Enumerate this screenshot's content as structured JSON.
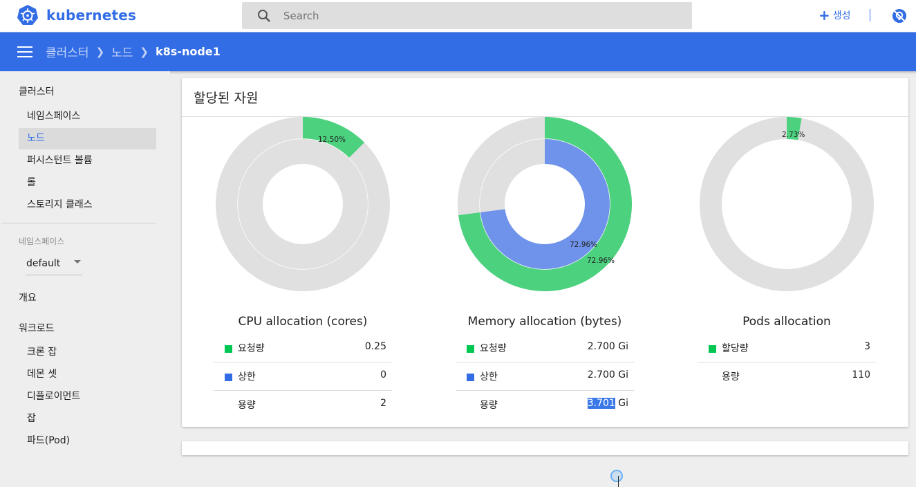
{
  "app": {
    "brand": "kubernetes"
  },
  "search": {
    "placeholder": "Search"
  },
  "toolbar": {
    "create_label": "생성",
    "create_symbol": "+"
  },
  "breadcrumb": {
    "items": [
      "클러스터",
      "노드",
      "k8s-node1"
    ]
  },
  "sidebar": {
    "cluster_heading": "클러스터",
    "cluster_items": [
      {
        "label": "네임스페이스",
        "active": false
      },
      {
        "label": "노드",
        "active": true
      },
      {
        "label": "퍼시스턴트 볼륨",
        "active": false
      },
      {
        "label": "롤",
        "active": false
      },
      {
        "label": "스토리지 클래스",
        "active": false
      }
    ],
    "namespace_label": "네임스페이스",
    "namespace_value": "default",
    "overview": "개요",
    "workloads_heading": "워크로드",
    "workload_items": [
      "크론 잡",
      "데몬 셋",
      "디플로이먼트",
      "잡",
      "파드(Pod)"
    ]
  },
  "card": {
    "title": "할당된 자원"
  },
  "colors": {
    "accent": "#326de6",
    "requests": "#00c752",
    "limits": "#326de6",
    "ring_bg": "#e0e0e0",
    "outer_green": "#4cd17e",
    "inner_blue": "#6f93ea"
  },
  "chart_data": [
    {
      "type": "pie",
      "title": "CPU allocation (cores)",
      "outer_percent": 12.5,
      "outer_label": "12.50%",
      "inner_percent": 0,
      "inner_label": "",
      "legend": [
        {
          "name": "요청량",
          "value": "0.25",
          "swatch": "requests"
        },
        {
          "name": "상한",
          "value": "0",
          "swatch": "limits"
        },
        {
          "name": "용량",
          "value": "2",
          "swatch": ""
        }
      ]
    },
    {
      "type": "pie",
      "title": "Memory allocation (bytes)",
      "outer_percent": 72.96,
      "outer_label": "72.96%",
      "inner_percent": 72.96,
      "inner_label": "72.96%",
      "legend": [
        {
          "name": "요청량",
          "value": "2.700 Gi",
          "swatch": "requests"
        },
        {
          "name": "상한",
          "value": "2.700 Gi",
          "swatch": "limits"
        },
        {
          "name": "용량",
          "value_selected": "3.701",
          "value_unit": "Gi",
          "swatch": ""
        }
      ]
    },
    {
      "type": "pie",
      "title": "Pods allocation",
      "outer_percent": 2.73,
      "outer_label": "2.73%",
      "inner_percent": null,
      "inner_label": "",
      "legend": [
        {
          "name": "할당량",
          "value": "3",
          "swatch": "requests"
        },
        {
          "name": "용량",
          "value": "110",
          "swatch": ""
        }
      ]
    }
  ]
}
